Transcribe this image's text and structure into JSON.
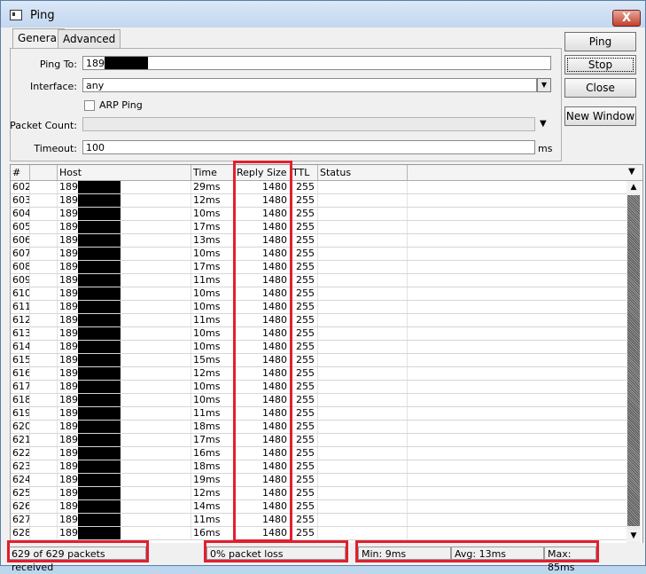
{
  "window": {
    "title": "Ping",
    "close_glyph": "X"
  },
  "tabs": [
    "General",
    "Advanced"
  ],
  "form": {
    "ping_to_label": "Ping To:",
    "ping_to_value": "189",
    "interface_label": "Interface:",
    "interface_value": "any",
    "arp_ping_label": "ARP Ping",
    "packet_count_label": "Packet Count:",
    "packet_count_value": "",
    "timeout_label": "Timeout:",
    "timeout_value": "100",
    "timeout_unit": "ms"
  },
  "buttons": {
    "ping": "Ping",
    "stop": "Stop",
    "close": "Close",
    "new_window": "New Window"
  },
  "table": {
    "columns": [
      "#",
      "",
      "Host",
      "Time",
      "Reply Size",
      "TTL",
      "Status"
    ],
    "host_prefix": "189",
    "rows": [
      [
        "602",
        "29ms",
        "1480",
        "255"
      ],
      [
        "603",
        "12ms",
        "1480",
        "255"
      ],
      [
        "604",
        "10ms",
        "1480",
        "255"
      ],
      [
        "605",
        "17ms",
        "1480",
        "255"
      ],
      [
        "606",
        "13ms",
        "1480",
        "255"
      ],
      [
        "607",
        "10ms",
        "1480",
        "255"
      ],
      [
        "608",
        "17ms",
        "1480",
        "255"
      ],
      [
        "609",
        "11ms",
        "1480",
        "255"
      ],
      [
        "610",
        "10ms",
        "1480",
        "255"
      ],
      [
        "611",
        "10ms",
        "1480",
        "255"
      ],
      [
        "612",
        "11ms",
        "1480",
        "255"
      ],
      [
        "613",
        "10ms",
        "1480",
        "255"
      ],
      [
        "614",
        "10ms",
        "1480",
        "255"
      ],
      [
        "615",
        "15ms",
        "1480",
        "255"
      ],
      [
        "616",
        "12ms",
        "1480",
        "255"
      ],
      [
        "617",
        "10ms",
        "1480",
        "255"
      ],
      [
        "618",
        "10ms",
        "1480",
        "255"
      ],
      [
        "619",
        "11ms",
        "1480",
        "255"
      ],
      [
        "620",
        "18ms",
        "1480",
        "255"
      ],
      [
        "621",
        "17ms",
        "1480",
        "255"
      ],
      [
        "622",
        "16ms",
        "1480",
        "255"
      ],
      [
        "623",
        "18ms",
        "1480",
        "255"
      ],
      [
        "624",
        "19ms",
        "1480",
        "255"
      ],
      [
        "625",
        "12ms",
        "1480",
        "255"
      ],
      [
        "626",
        "14ms",
        "1480",
        "255"
      ],
      [
        "627",
        "11ms",
        "1480",
        "255"
      ],
      [
        "628",
        "16ms",
        "1480",
        "255"
      ]
    ]
  },
  "status": {
    "received": "629 of 629 packets received",
    "loss": "0% packet loss",
    "min": "Min: 9ms",
    "avg": "Avg: 13ms",
    "max": "Max: 85ms"
  },
  "colors": {
    "highlight": "#e0202e",
    "redaction": "#000000"
  },
  "icons": [
    "app-window-icon",
    "close-icon",
    "dropdown-arrow-icon",
    "scroll-up-icon",
    "scroll-down-icon"
  ]
}
